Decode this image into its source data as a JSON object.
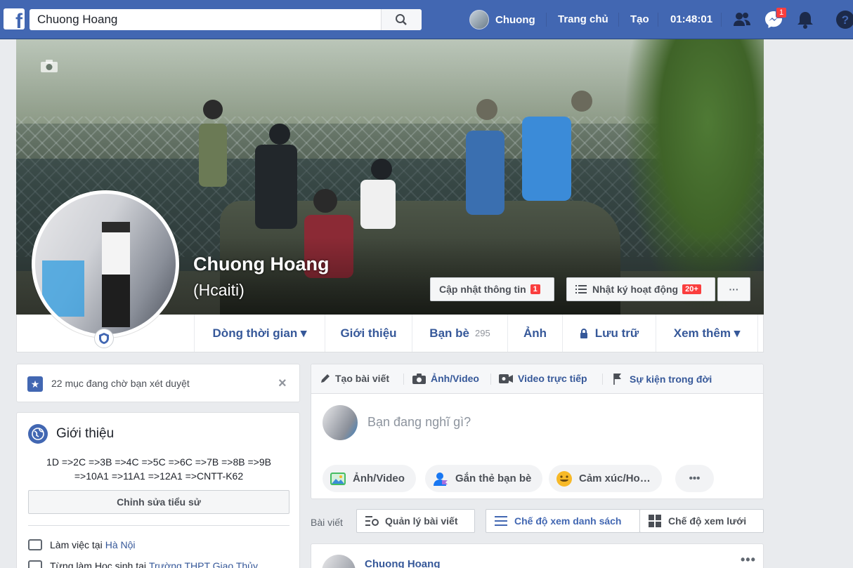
{
  "search": {
    "value": "Chuong Hoang"
  },
  "nav": {
    "user": "Chuong",
    "home": "Trang chủ",
    "create": "Tạo",
    "clock": "01:48:01",
    "messenger_badge": "1"
  },
  "profile": {
    "name": "Chuong Hoang",
    "alt_name": "(Hcaiti)",
    "update_info": "Cập nhật thông tin",
    "update_info_badge": "1",
    "activity_log": "Nhật ký hoạt động",
    "activity_log_badge": "20+",
    "more": "···"
  },
  "tabs": [
    {
      "label": "Dòng thời gian ▾"
    },
    {
      "label": "Giới thiệu"
    },
    {
      "label": "Bạn bè",
      "count": "295"
    },
    {
      "label": "Ảnh"
    },
    {
      "label": "Lưu trữ"
    },
    {
      "label": "Xem thêm ▾"
    }
  ],
  "pending": {
    "text": "22 mục đang chờ bạn xét duyệt",
    "close": "×"
  },
  "intro": {
    "title": "Giới thiệu",
    "bio_line1": "1D =>2C =>3B =>4C =>5C =>6C =>7B =>8B =>9B",
    "bio_line2": "=>10A1 =>11A1 =>12A1 =>CNTT-K62",
    "edit_bio": "Chỉnh sửa tiểu sử",
    "work_prefix": "Làm việc tại",
    "work_place": "Hà Nội",
    "study_prefix": "Từng làm Học sinh tại",
    "study_place": "Trường THPT Giao Thủy"
  },
  "composer": {
    "tab_create": "Tạo bài viết",
    "tab_photo": "Ảnh/Video",
    "tab_live": "Video trực tiếp",
    "tab_event": "Sự kiện trong đời",
    "placeholder": "Bạn đang nghĩ gì?",
    "pill_photo": "Ảnh/Video",
    "pill_tag": "Gắn thẻ bạn bè",
    "pill_feeling": "Cảm xúc/Ho…",
    "pill_more": "•••"
  },
  "posts_filter": {
    "label": "Bài viết",
    "manage": "Quản lý bài viết",
    "list_view": "Chế độ xem danh sách",
    "grid_view": "Chế độ xem lưới"
  },
  "post": {
    "author": "Chuong Hoang",
    "more": "•••"
  }
}
